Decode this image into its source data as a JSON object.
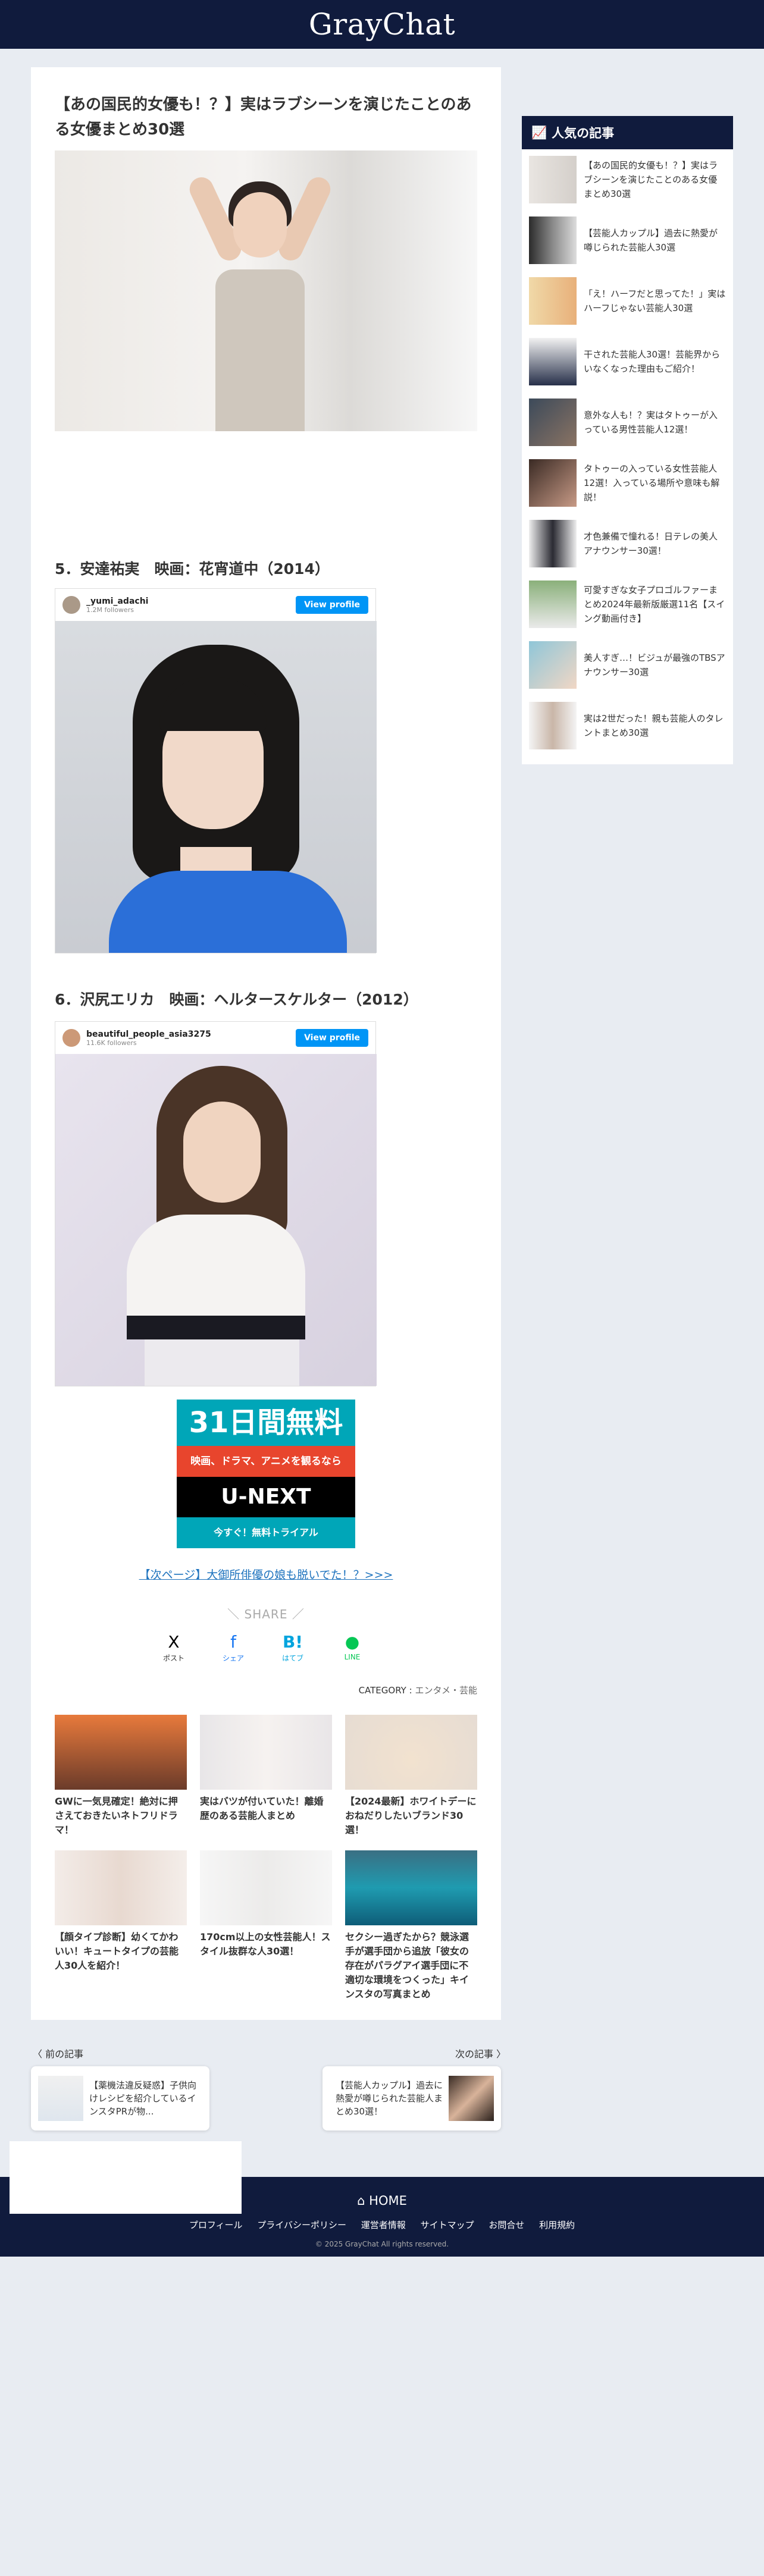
{
  "site": {
    "logo": "GrayChat"
  },
  "article": {
    "title": "【あの国民的女優も！？】実はラブシーンを演じたことのある女優まとめ30選",
    "sections": [
      {
        "heading": "5．安達祐実　映画：花宵道中（2014）",
        "ig_user": "_yumi_adachi",
        "ig_followers": "1.2M followers",
        "ig_button": "View profile"
      },
      {
        "heading": "6．沢尻エリカ　映画：ヘルタースケルター（2012）",
        "ig_user": "beautiful_people_asia3275",
        "ig_followers": "11.6K followers",
        "ig_button": "View profile"
      }
    ],
    "ad": {
      "line1": "31日間無料",
      "line2": "映画、ドラマ、アニメを観るなら",
      "line3": "U-NEXT",
      "line4": "今すぐ！無料トライアル"
    },
    "next_link": "【次ページ】大御所俳優の娘も脱いでた！？>>>",
    "share_label": "＼ SHARE ／",
    "share": [
      {
        "icon": "X",
        "label": "ポスト",
        "color": "#000000"
      },
      {
        "icon": "f",
        "label": "シェア",
        "color": "#1877f2"
      },
      {
        "icon": "B!",
        "label": "はてブ",
        "color": "#00a4de"
      },
      {
        "icon": "●",
        "label": "LINE",
        "color": "#06c755"
      }
    ],
    "category_label": "CATEGORY :",
    "category_value": "エンタメ・芸能",
    "related": [
      {
        "title": "GWに一気見確定！絶対に押さえておきたいネトフリドラマ！"
      },
      {
        "title": "実はバツが付いていた！離婚歴のある芸能人まとめ"
      },
      {
        "title": "【2024最新】ホワイトデーにおねだりしたいブランド30選！"
      },
      {
        "title": "【顔タイプ診断】幼くてかわいい！キュートタイプの芸能人30人を紹介！"
      },
      {
        "title": "170cm以上の女性芸能人！スタイル抜群な人30選！"
      },
      {
        "title": "セクシー過ぎたから？競泳選手が選手団から追放「彼女の存在がパラグアイ選手団に不適切な環境をつくった」キインスタの写真まとめ"
      }
    ]
  },
  "prev_next": {
    "prev_label": "〈 前の記事",
    "next_label": "次の記事 〉",
    "prev_title": "【薬機法違反疑惑】子供向けレシピを紹介しているインスタPRが物...",
    "next_title": "【芸能人カップル】過去に熱愛が噂じられた芸能人まとめ30選！"
  },
  "sidebar": {
    "heading": "人気の記事",
    "items": [
      {
        "title": "【あの国民的女優も！？】実はラブシーンを演じたことのある女優まとめ30選"
      },
      {
        "title": "【芸能人カップル】過去に熱愛が噂じられた芸能人30選"
      },
      {
        "title": "「え！ハーフだと思ってた！」実はハーフじゃない芸能人30選"
      },
      {
        "title": "干された芸能人30選！芸能界からいなくなった理由もご紹介！"
      },
      {
        "title": "意外な人も！？実はタトゥーが入っている男性芸能人12選！"
      },
      {
        "title": "タトゥーの入っている女性芸能人12選！入っている場所や意味も解説！"
      },
      {
        "title": "才色兼備で憧れる！日テレの美人アナウンサー30選！"
      },
      {
        "title": "可愛すぎな女子プロゴルファーまとめ2024年最新版厳選11名【スイング動画付き】"
      },
      {
        "title": "美人すぎ…！ビジュが最強のTBSアナウンサー30選"
      },
      {
        "title": "実は2世だった！親も芸能人のタレントまとめ30選"
      }
    ]
  },
  "footer": {
    "home": "HOME",
    "links": [
      "プロフィール",
      "プライバシーポリシー",
      "運営者情報",
      "サイトマップ",
      "お問合せ",
      "利用規約"
    ],
    "copyright": "© 2025 GrayChat All rights reserved."
  },
  "colors": {
    "navy": "#101b3d",
    "link": "#1e73be",
    "ig_button": "#0095f6",
    "unext_teal": "#00a6b8",
    "unext_red": "#e8452d"
  }
}
